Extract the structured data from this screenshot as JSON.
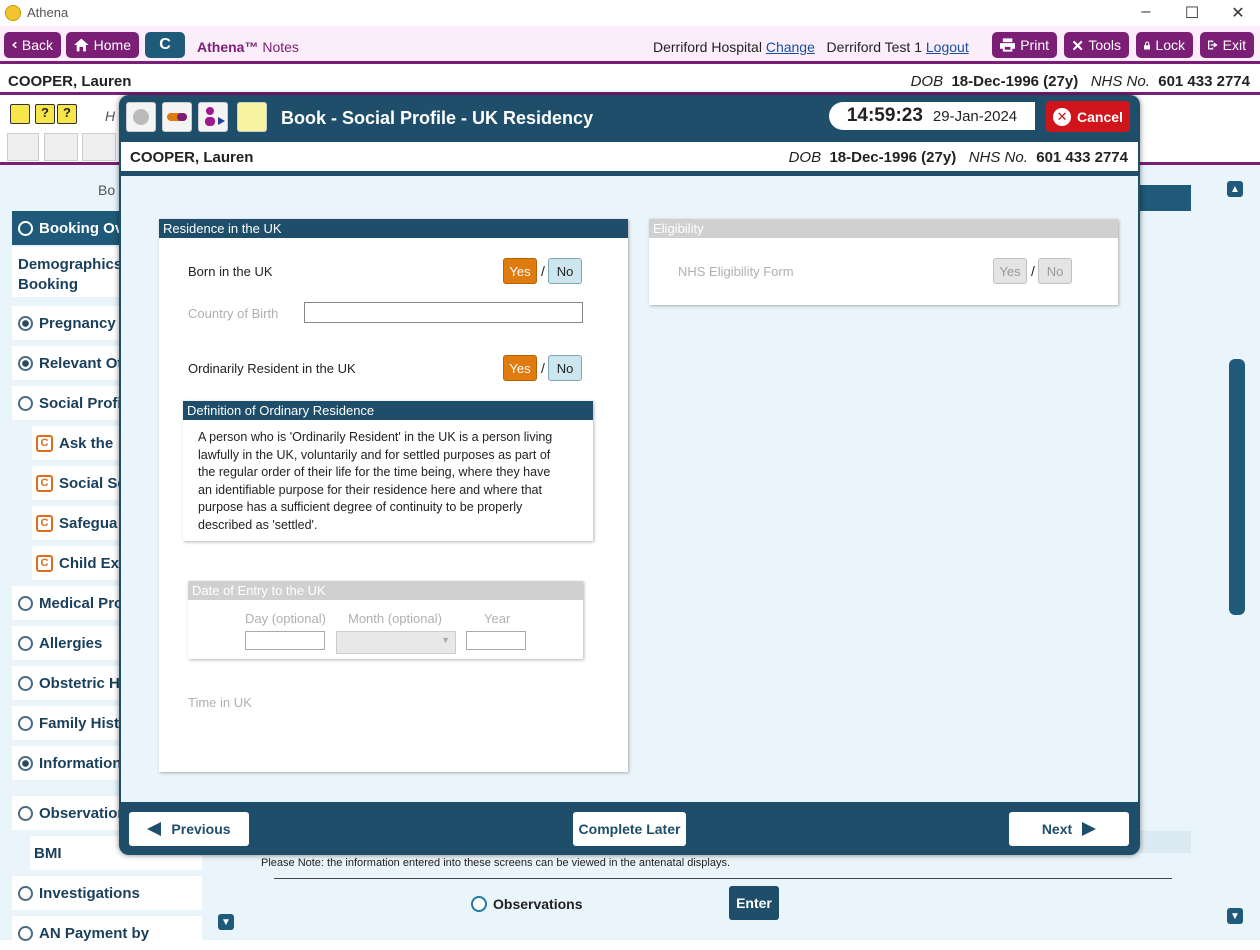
{
  "window": {
    "title": "Athena"
  },
  "toolbar": {
    "back": "Back",
    "home": "Home",
    "c": "C",
    "brand": "Athena™",
    "notes": "Notes",
    "hospital": "Derriford Hospital",
    "change": "Change",
    "user": "Derriford Test 1",
    "logout": "Logout",
    "print": "Print",
    "tools": "Tools",
    "lock": "Lock",
    "exit": "Exit"
  },
  "patient": {
    "name": "COOPER, Lauren",
    "dob_label": "DOB",
    "dob": "18-Dec-1996 (27y)",
    "nhs_label": "NHS No.",
    "nhs": "601 433 2774"
  },
  "background": {
    "section_title": "Bo",
    "side_h": "H",
    "nav": [
      {
        "label": "Booking Ov",
        "state": "selected"
      },
      {
        "label": "Demographics",
        "label2": "Booking"
      },
      {
        "label": "Pregnancy I",
        "state": "filled"
      },
      {
        "label": "Relevant Ot",
        "state": "filled"
      },
      {
        "label": "Social Profil",
        "state": "empty"
      },
      {
        "label": "Ask the",
        "sub": true
      },
      {
        "label": "Social Se",
        "sub": true
      },
      {
        "label": "Safegua",
        "sub": true
      },
      {
        "label": "Child Exp",
        "sub": true
      },
      {
        "label": "Medical Pro",
        "state": "empty"
      },
      {
        "label": "Allergies",
        "state": "empty"
      },
      {
        "label": "Obstetric H",
        "state": "empty"
      },
      {
        "label": "Family Histo",
        "state": "empty"
      },
      {
        "label": "Information",
        "state": "filled"
      },
      {
        "label": "Observation",
        "state": "empty"
      },
      {
        "label": "BMI",
        "state": "empty",
        "sub": true
      },
      {
        "label": "Investigations",
        "state": "empty"
      },
      {
        "label": "AN Payment by",
        "state": "empty"
      }
    ],
    "note": "Please Note: the information entered into these screens can be viewed in the antenatal displays.",
    "observations": "Observations",
    "enter": "Enter"
  },
  "modal": {
    "title": "Book - Social Profile - UK Residency",
    "time": "14:59:23",
    "date": "29-Jan-2024",
    "cancel": "Cancel",
    "residence": {
      "header": "Residence in the UK",
      "born": "Born in the UK",
      "yes": "Yes",
      "no": "No",
      "country": "Country of Birth",
      "resident": "Ordinarily Resident in the UK",
      "definition_header": "Definition of Ordinary Residence",
      "definition": [
        "A person who is 'Ordinarily Resident' in the UK is a person living",
        "lawfully in the UK, voluntarily and for settled purposes as part of",
        "the regular order of their life for the time being, where they have",
        "an identifiable purpose for their residence here and where that",
        "purpose has a sufficient degree of continuity to be properly",
        "described as 'settled'."
      ],
      "entry_header": "Date of Entry to the UK",
      "day": "Day (optional)",
      "month": "Month (optional)",
      "year": "Year",
      "time_in_uk": "Time in UK"
    },
    "eligibility": {
      "header": "Eligibility",
      "form": "NHS Eligibility Form",
      "yes": "Yes",
      "no": "No"
    },
    "footer": {
      "previous": "Previous",
      "complete_later": "Complete Later",
      "next": "Next"
    }
  }
}
